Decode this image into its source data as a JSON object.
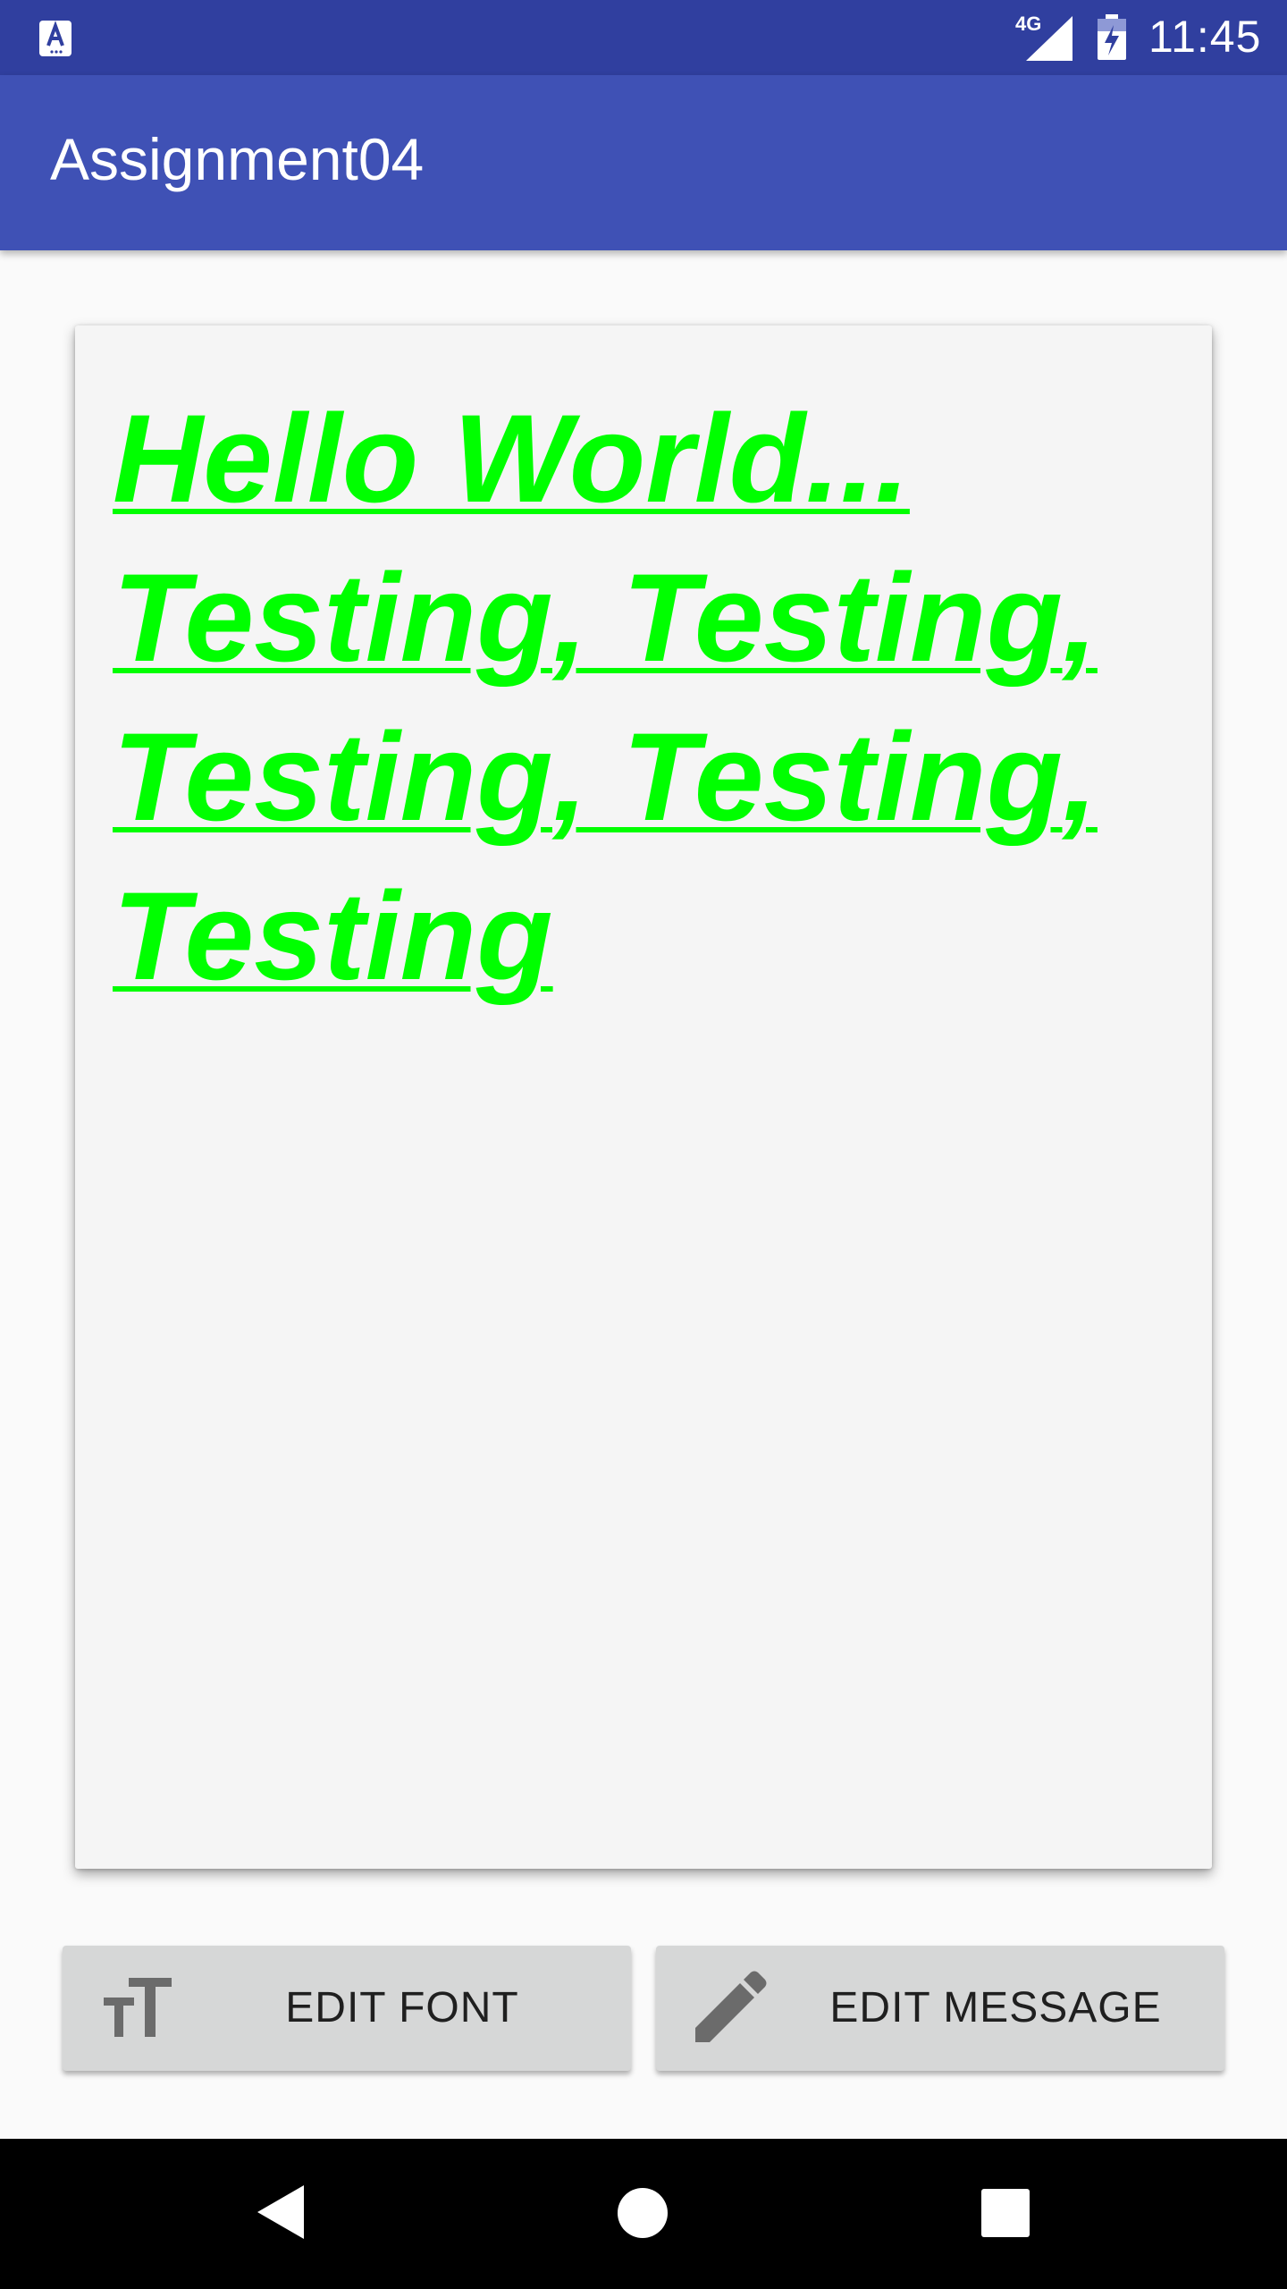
{
  "status_bar": {
    "network_type": "4G",
    "time": "11:45",
    "icons": [
      "app-notification-icon",
      "signal-icon",
      "battery-icon"
    ]
  },
  "app_bar": {
    "title": "Assignment04"
  },
  "message": {
    "text": "Hello World... Testing, Testing, Testing, Testing, Testing",
    "color": "#00ff00",
    "style": "bold italic underline"
  },
  "buttons": {
    "edit_font": {
      "label": "EDIT FONT",
      "icon": "text-size-icon"
    },
    "edit_message": {
      "label": "EDIT MESSAGE",
      "icon": "pencil-icon"
    }
  },
  "nav_bar": {
    "icons": [
      "back-icon",
      "home-icon",
      "recents-icon"
    ]
  },
  "colors": {
    "status_bar": "#303f9f",
    "app_bar": "#3f51b5",
    "card_background": "#f5f5f5",
    "button_background": "#d6d7d7",
    "nav_bar": "#000000"
  }
}
